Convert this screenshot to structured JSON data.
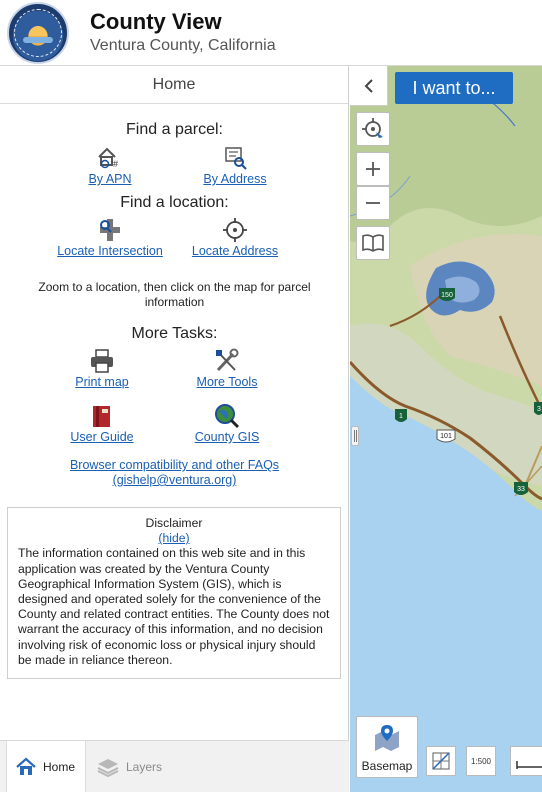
{
  "header": {
    "title": "County View",
    "subtitle": "Ventura County, California"
  },
  "panel": {
    "title": "Home",
    "find_parcel": {
      "heading": "Find a parcel:",
      "by_apn": "By APN",
      "by_address": "By Address"
    },
    "find_location": {
      "heading": "Find a location:",
      "locate_intersection": "Locate Intersection",
      "locate_address": "Locate Address"
    },
    "zoom_text": "Zoom to a location, then click on the map for parcel information",
    "more_tasks": {
      "heading": "More Tasks:",
      "print_map": "Print map",
      "more_tools": "More Tools",
      "user_guide": "User Guide",
      "county_gis": "County GIS"
    },
    "faq_link": "Browser compatibility and other FAQs",
    "faq_email": "(gishelp@ventura.org)",
    "disclaimer": {
      "title": "Disclaimer",
      "hide": "(hide)",
      "body": "The information contained on this web site and in this application was created by the Ventura County Geographical Information System (GIS), which is designed and operated solely for the convenience of the County and related contract entities. The County does not warrant the accuracy of this information, and no decision involving risk of economic loss or physical injury should be made in reliance thereon."
    }
  },
  "tabs": {
    "home": "Home",
    "layers": "Layers"
  },
  "map": {
    "i_want_to": "I want to...",
    "basemap": "Basemap",
    "scale_tool": "1:500",
    "route_labels": [
      "150",
      "1",
      "101",
      "33",
      "3"
    ]
  },
  "colors": {
    "link": "#1a5fb4",
    "accent": "#1f6dc2",
    "ocean": "#a9d1f0",
    "land": "#c8d6a6"
  }
}
